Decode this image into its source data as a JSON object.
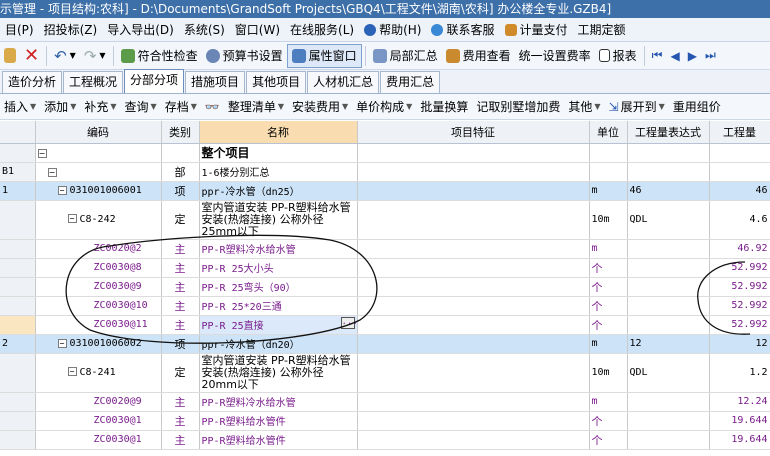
{
  "titlebar": {
    "text": "示管理 - 项目结构:农科] - D:\\Documents\\GrandSoft Projects\\GBQ4\\工程文件\\湖南\\农科] 办公楼全专业.GZB4]"
  },
  "menu": {
    "items": [
      "目(P)",
      "招投标(Z)",
      "导入导出(D)",
      "系统(S)",
      "窗口(W)",
      "在线服务(L)",
      "帮助(H)",
      "联系客服",
      "计量支付",
      "工期定额"
    ]
  },
  "toolbar": {
    "check": "符合性检查",
    "budget": "预算书设置",
    "attr": "属性窗口",
    "local": "局部汇总",
    "fee_view": "费用查看",
    "unify_rate": "统一设置费率",
    "report": "报表"
  },
  "tabs": [
    "造价分析",
    "工程概况",
    "分部分项",
    "措施项目",
    "其他项目",
    "人材机汇总",
    "费用汇总"
  ],
  "toolbar2": [
    "插入",
    "添加",
    "补充",
    "查询",
    "存档",
    "整理清单",
    "安装费用",
    "单价构成",
    "批量换算",
    "记取别墅增加费",
    "其他",
    "展开到",
    "重用组价"
  ],
  "columns": [
    "编码",
    "类别",
    "名称",
    "项目特征",
    "单位",
    "工程量表达式",
    "工程量"
  ],
  "rows": [
    {
      "no": "",
      "code": "",
      "type": "",
      "name": "整个项目",
      "unit": "",
      "expr": "",
      "qty": ""
    },
    {
      "no": "B1",
      "code": "",
      "type": "部",
      "name": "1-6楼分别汇总",
      "unit": "",
      "expr": "",
      "qty": ""
    },
    {
      "no": "1",
      "code": "031001006001",
      "type": "项",
      "name": "ppr-冷水管（dn25）",
      "unit": "m",
      "expr": "46",
      "qty": "46"
    },
    {
      "no": "",
      "code": "C8-242",
      "type": "定",
      "name": "室内管道安装 PP-R塑料给水管安装(热熔连接) 公称外径25mm以下",
      "unit": "10m",
      "expr": "QDL",
      "qty": "4.6"
    },
    {
      "no": "",
      "code": "ZC0020@2",
      "type": "主",
      "name": "PP-R塑料冷水给水管",
      "unit": "m",
      "expr": "",
      "qty": "46.92"
    },
    {
      "no": "",
      "code": "ZC0030@8",
      "type": "主",
      "name": "PP-R 25大小头",
      "unit": "个",
      "expr": "",
      "qty": "52.992"
    },
    {
      "no": "",
      "code": "ZC0030@9",
      "type": "主",
      "name": "PP-R 25弯头（90）",
      "unit": "个",
      "expr": "",
      "qty": "52.992"
    },
    {
      "no": "",
      "code": "ZC0030@10",
      "type": "主",
      "name": "PP-R 25*20三通",
      "unit": "个",
      "expr": "",
      "qty": "52.992"
    },
    {
      "no": "",
      "code": "ZC0030@11",
      "type": "主",
      "name": "PP-R 25直接",
      "unit": "个",
      "expr": "",
      "qty": "52.992"
    },
    {
      "no": "2",
      "code": "031001006002",
      "type": "项",
      "name": "ppr-冷水管（dn20）",
      "unit": "m",
      "expr": "12",
      "qty": "12"
    },
    {
      "no": "",
      "code": "C8-241",
      "type": "定",
      "name": "室内管道安装 PP-R塑料给水管安装(热熔连接) 公称外径20mm以下",
      "unit": "10m",
      "expr": "QDL",
      "qty": "1.2"
    },
    {
      "no": "",
      "code": "ZC0020@9",
      "type": "主",
      "name": "PP-R塑料冷水给水管",
      "unit": "m",
      "expr": "",
      "qty": "12.24"
    },
    {
      "no": "",
      "code": "ZC0030@1",
      "type": "主",
      "name": "PP-R塑料给水管件",
      "unit": "个",
      "expr": "",
      "qty": "19.644"
    },
    {
      "no": "",
      "code": "ZC0030@1",
      "type": "主",
      "name": "PP-R塑料给水管件",
      "unit": "个",
      "expr": "",
      "qty": "19.644"
    }
  ]
}
